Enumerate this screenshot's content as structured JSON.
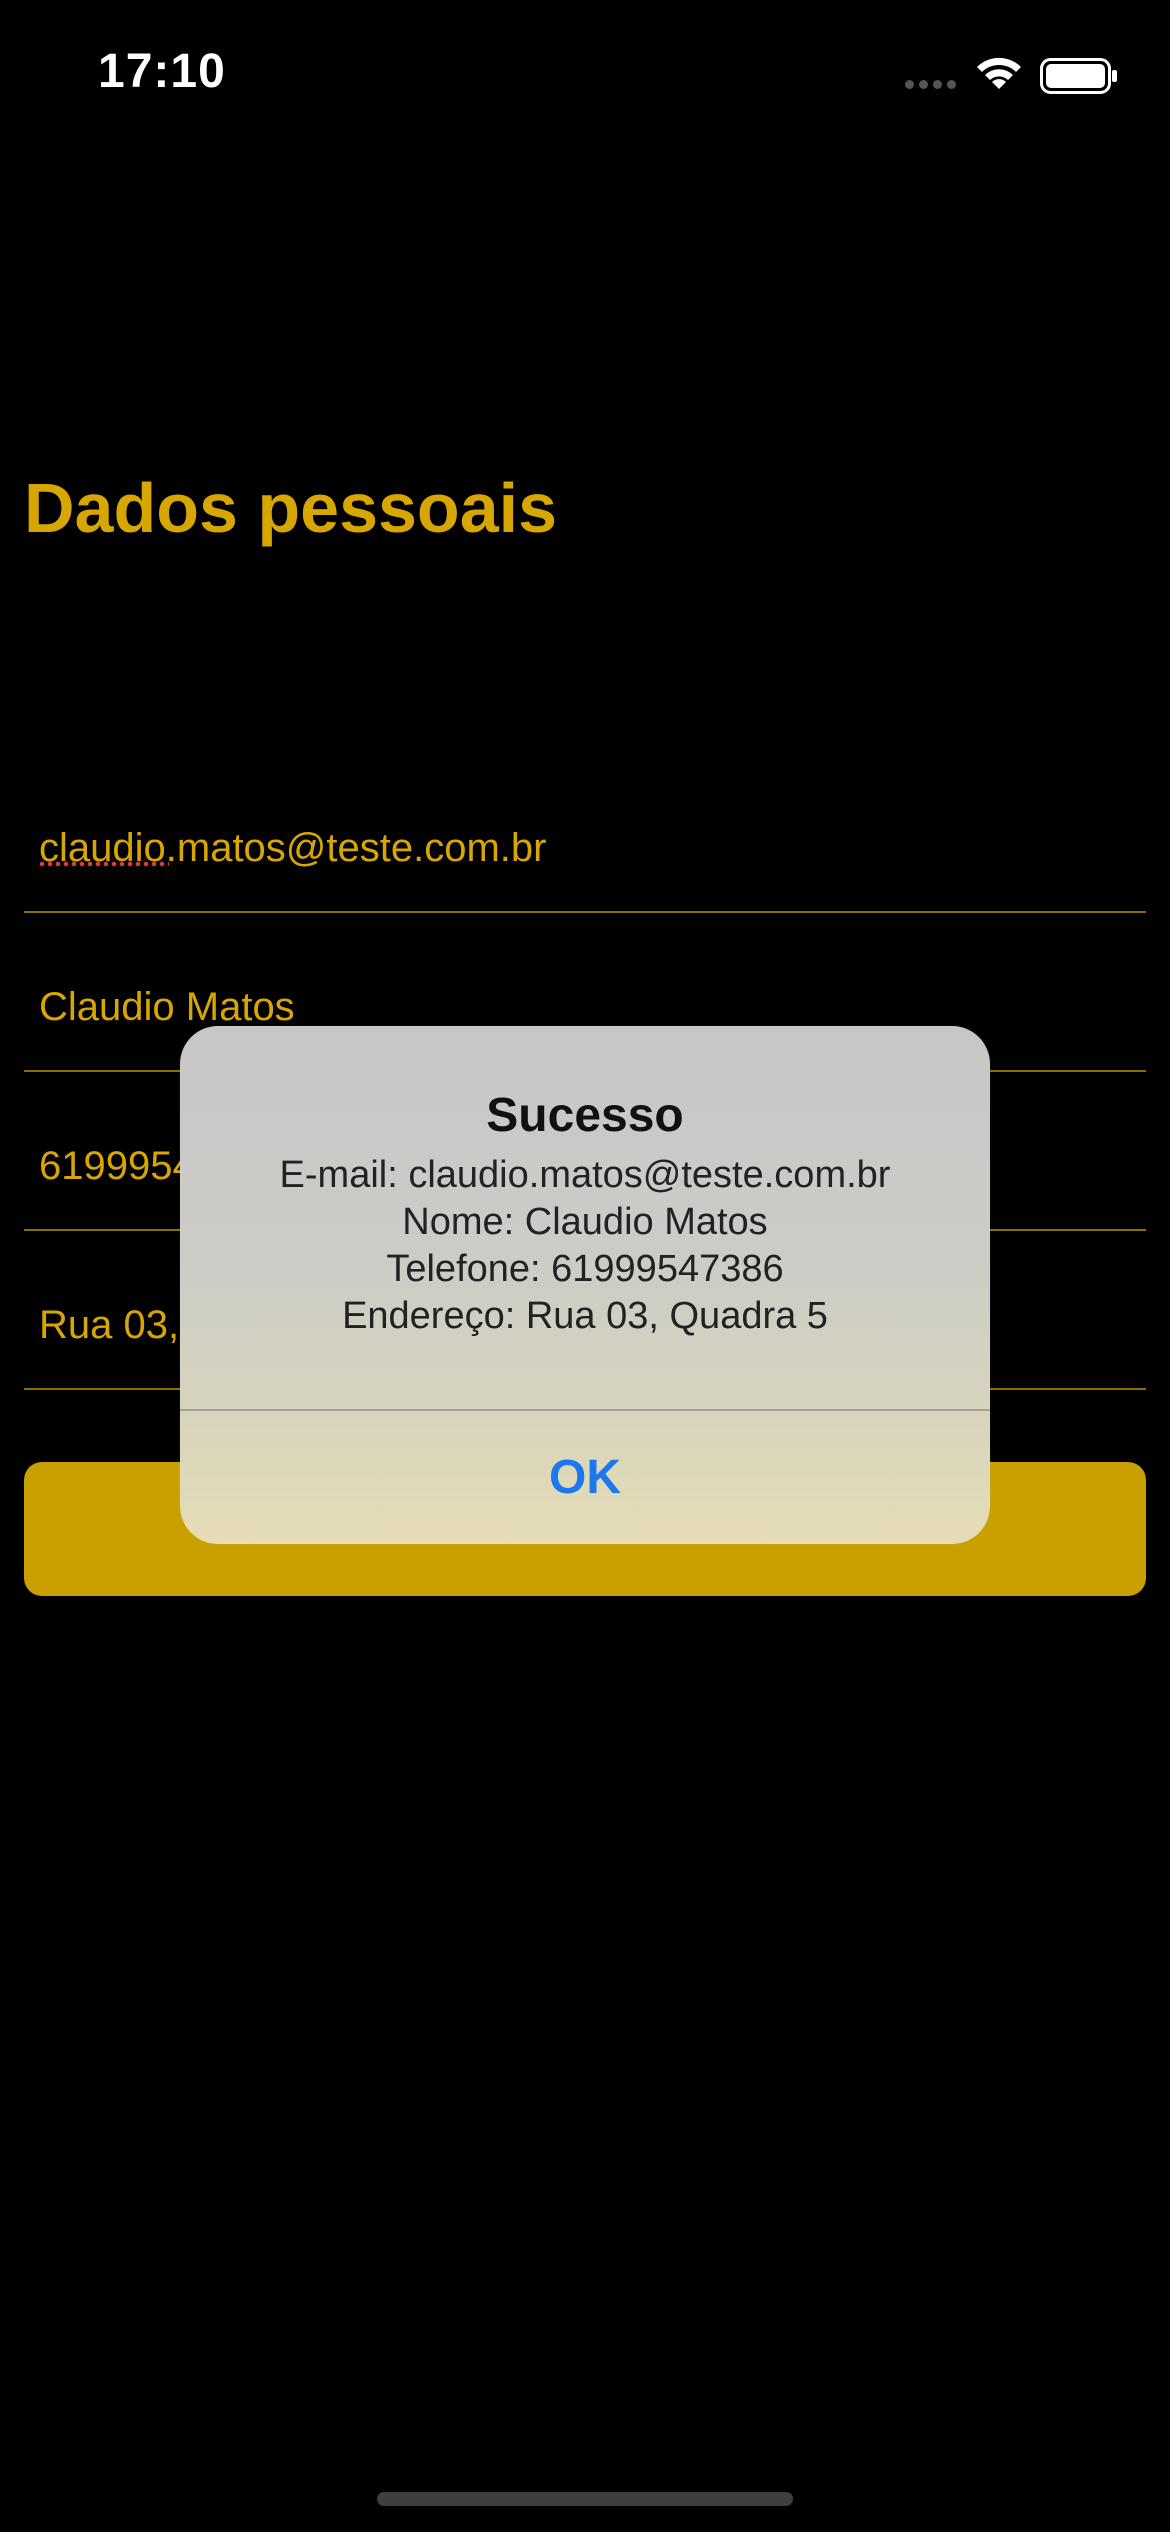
{
  "status_bar": {
    "time": "17:10",
    "icons": [
      "signal-dots-icon",
      "wifi-icon",
      "battery-icon"
    ]
  },
  "screen": {
    "title": "Dados pessoais"
  },
  "fields": {
    "email": "claudio.matos@teste.com.br",
    "name": "Claudio Matos",
    "phone": "61999547386",
    "address": "Rua 03, Quadra 5"
  },
  "alert": {
    "title": "Sucesso",
    "lines": [
      "E-mail: claudio.matos@teste.com.br",
      "Nome: Claudio Matos",
      "Telefone: 61999547386",
      "Endereço: Rua 03, Quadra 5"
    ],
    "ok_label": "OK"
  },
  "colors": {
    "background": "#000000",
    "accent": "#d8a600",
    "button": "#c9a000",
    "alert_link": "#1b78ef"
  }
}
